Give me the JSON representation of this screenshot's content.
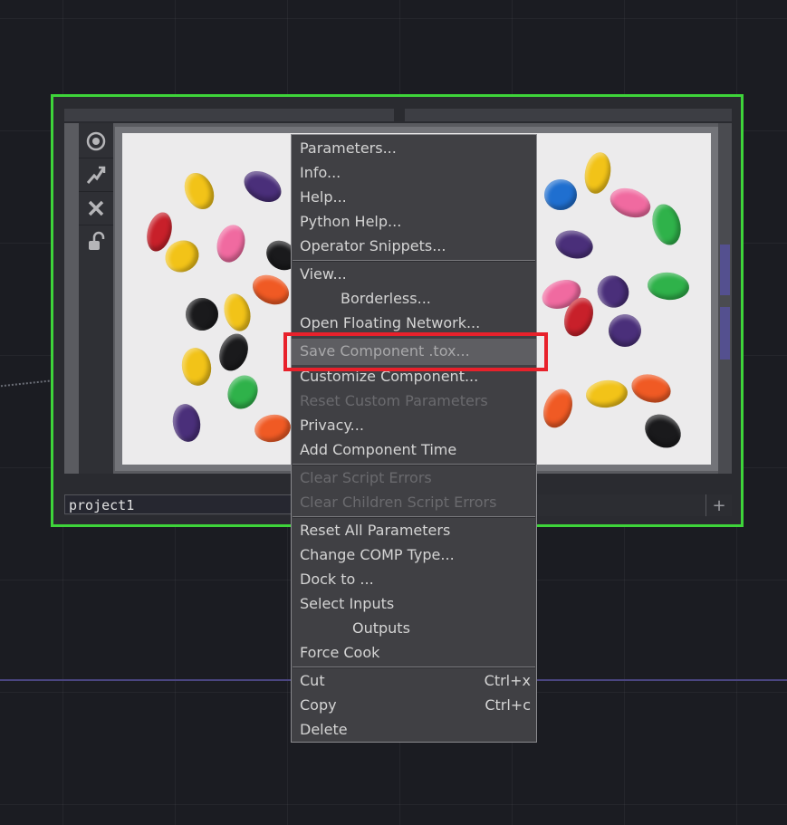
{
  "node": {
    "name": "project1",
    "border_color": "#3ed43a",
    "toolbar_icons": [
      "viewer-active-icon",
      "bypass-icon",
      "close-icon",
      "lock-icon"
    ]
  },
  "context_menu": {
    "groups": [
      [
        {
          "label": "Parameters...",
          "enabled": true
        },
        {
          "label": "Info...",
          "enabled": true
        },
        {
          "label": "Help...",
          "enabled": true
        },
        {
          "label": "Python Help...",
          "enabled": true
        },
        {
          "label": "Operator Snippets...",
          "enabled": true
        }
      ],
      [
        {
          "label": "View...",
          "enabled": true
        },
        {
          "label": "Borderless...",
          "enabled": true,
          "indent": true
        },
        {
          "label": "Open Floating Network...",
          "enabled": true
        },
        {
          "label": "Save Component .tox...",
          "enabled": true,
          "highlighted": true
        },
        {
          "label": "Customize Component...",
          "enabled": true
        },
        {
          "label": "Reset Custom Parameters",
          "enabled": false
        },
        {
          "label": "Privacy...",
          "enabled": true
        },
        {
          "label": "Add Component Time",
          "enabled": true
        }
      ],
      [
        {
          "label": "Clear Script Errors",
          "enabled": false
        },
        {
          "label": "Clear Children Script Errors",
          "enabled": false
        }
      ],
      [
        {
          "label": "Reset All Parameters",
          "enabled": true
        },
        {
          "label": "Change COMP Type...",
          "enabled": true
        },
        {
          "label": "Dock to ...",
          "enabled": true
        },
        {
          "label": "Select Inputs",
          "enabled": true
        },
        {
          "label": "Outputs",
          "enabled": true,
          "indent": true
        },
        {
          "label": "Force Cook",
          "enabled": true
        }
      ],
      [
        {
          "label": "Cut",
          "shortcut": "Ctrl+x",
          "enabled": true
        },
        {
          "label": "Copy",
          "shortcut": "Ctrl+c",
          "enabled": true
        },
        {
          "label": "Delete",
          "enabled": true
        }
      ]
    ]
  },
  "callout_color": "#e8212b"
}
